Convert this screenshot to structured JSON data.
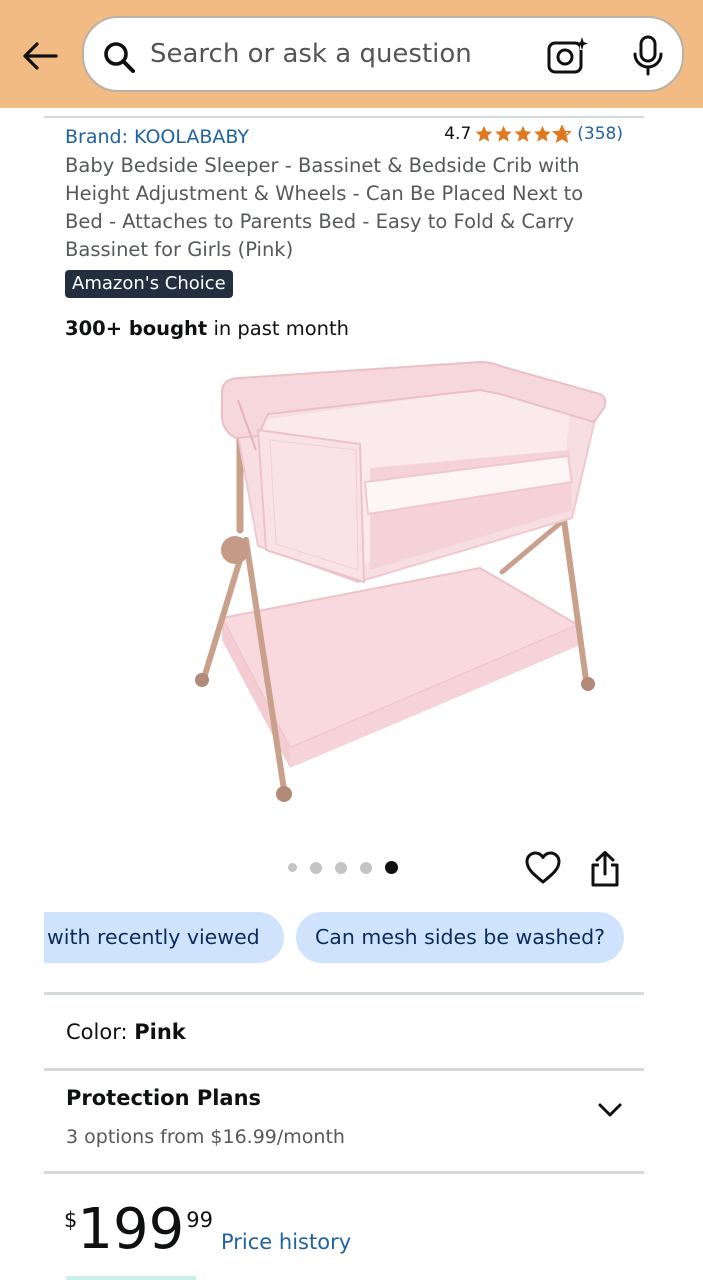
{
  "search": {
    "placeholder": "Search or ask a question"
  },
  "product": {
    "brand": "Brand: KOOLABABY",
    "rating": "4.7",
    "rating_count": "(358)",
    "stars": 4.7,
    "title": "Baby Bedside Sleeper - Bassinet & Bedside Crib with Height Adjustment & Wheels - Can Be Placed Next to Bed - Attaches to Parents Bed - Easy to Fold & Carry Bassinet for Girls (Pink)",
    "badge": "Amazon's Choice",
    "bought_bold": "300+ bought",
    "bought_rest": "in past month"
  },
  "carousel": {
    "total": 5,
    "active": 5
  },
  "chips": [
    "with recently viewed",
    "Can mesh sides be washed?"
  ],
  "color": {
    "label": "Color:",
    "value": "Pink"
  },
  "protection": {
    "title": "Protection Plans",
    "subtitle": "3 options from $16.99/month"
  },
  "price": {
    "symbol": "$",
    "whole": "199",
    "fraction": "99",
    "history": "Price history"
  },
  "colors": {
    "header": "#f2bb84",
    "link": "#2162a1",
    "star": "#de7921",
    "chip": "#cfe4fc"
  }
}
